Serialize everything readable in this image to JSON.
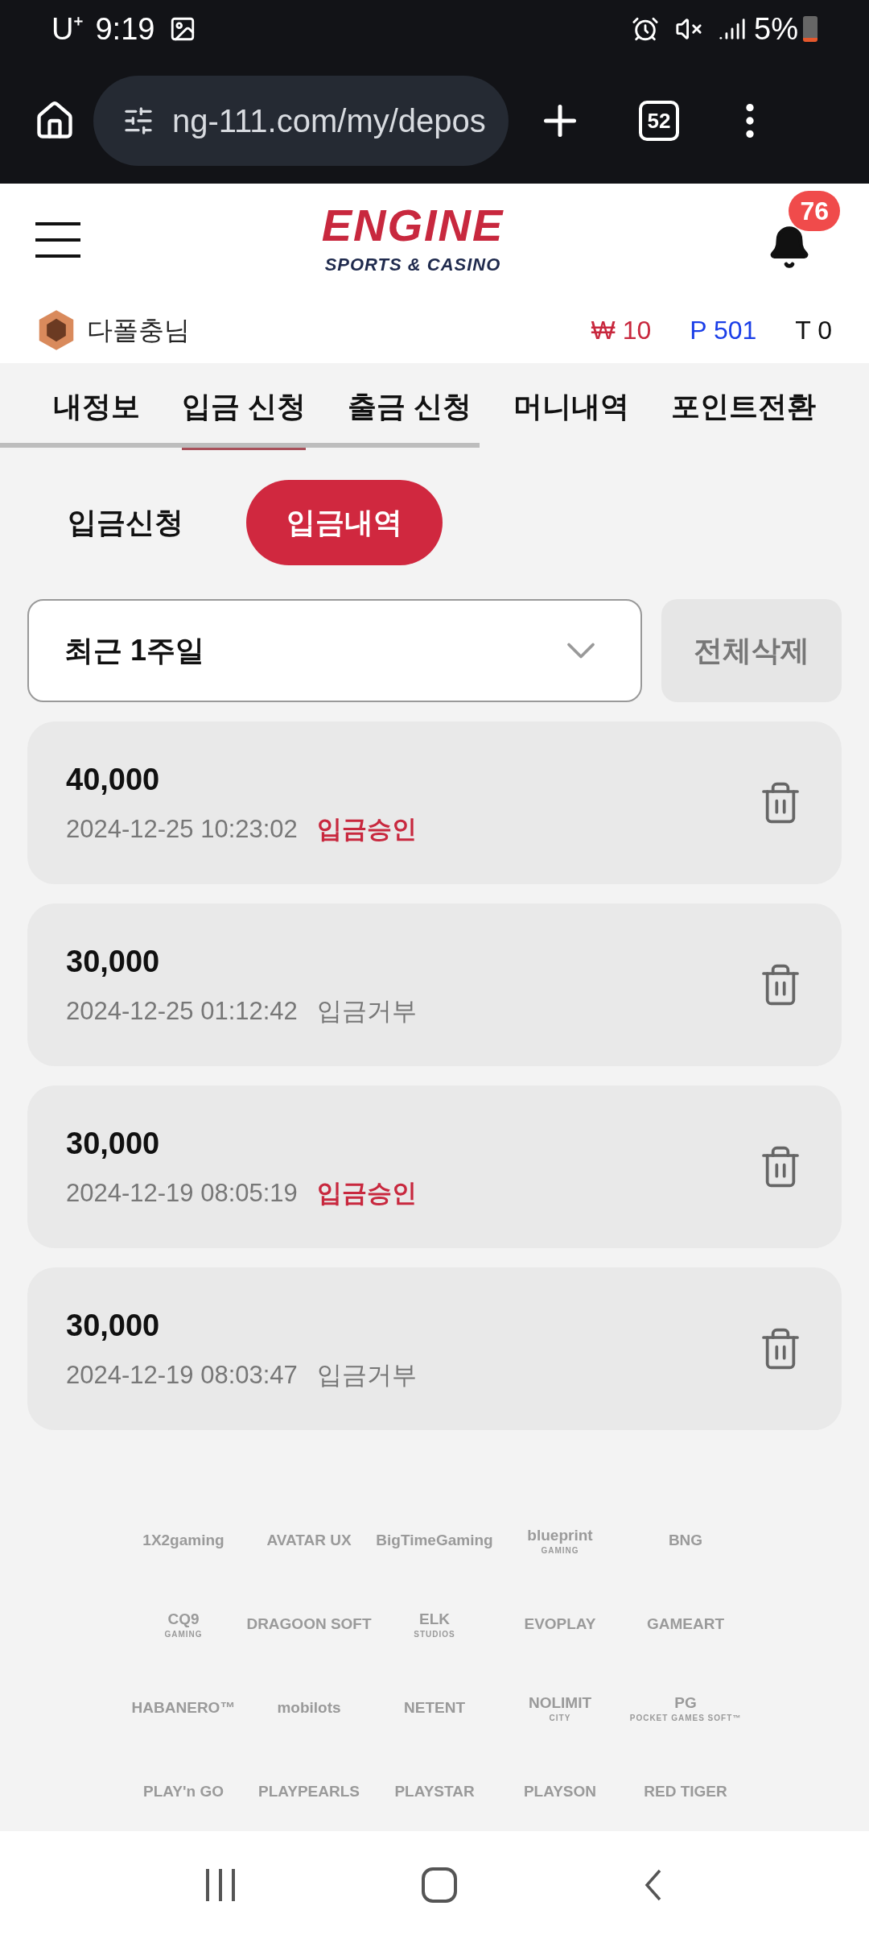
{
  "status_bar": {
    "carrier": "U⁺",
    "time": "9:19",
    "battery": "5%"
  },
  "browser": {
    "url": "ng-111.com/my/depos",
    "tab_count": "52"
  },
  "header": {
    "logo_title": "ENGINE",
    "logo_subtitle": "SPORTS & CASINO",
    "notification_count": "76"
  },
  "user": {
    "name": "다폴충님",
    "balances": [
      {
        "text": "₩ 10",
        "color": "#c8283e"
      },
      {
        "text": "P 501",
        "color": "#1a3ee8"
      },
      {
        "text": "T 0",
        "color": "#111111"
      }
    ]
  },
  "tabs": [
    {
      "label": "내정보",
      "selected": false
    },
    {
      "label": "입금 신청",
      "selected": true
    },
    {
      "label": "출금 신청",
      "selected": false
    },
    {
      "label": "머니내역",
      "selected": false
    },
    {
      "label": "포인트전환",
      "selected": false
    }
  ],
  "sub_tabs": [
    {
      "label": "입금신청",
      "selected": false
    },
    {
      "label": "입금내역",
      "selected": true
    }
  ],
  "filter": {
    "value": "최근 1주일",
    "delete_all": "전체삭제"
  },
  "records": [
    {
      "amount": "40,000",
      "datetime": "2024-12-25 10:23:02",
      "status": "입금승인",
      "kind": "approved"
    },
    {
      "amount": "30,000",
      "datetime": "2024-12-25 01:12:42",
      "status": "입금거부",
      "kind": "rejected"
    },
    {
      "amount": "30,000",
      "datetime": "2024-12-19 08:05:19",
      "status": "입금승인",
      "kind": "approved"
    },
    {
      "amount": "30,000",
      "datetime": "2024-12-19 08:03:47",
      "status": "입금거부",
      "kind": "rejected"
    }
  ],
  "providers": [
    {
      "name": "1X2gaming"
    },
    {
      "name": "AVATAR UX"
    },
    {
      "name": "BigTimeGaming"
    },
    {
      "name": "blueprint",
      "sub": "GAMING"
    },
    {
      "name": "BNG"
    },
    {
      "name": "CQ9",
      "sub": "GAMING"
    },
    {
      "name": "DRAGOON SOFT"
    },
    {
      "name": "ELK",
      "sub": "STUDIOS"
    },
    {
      "name": "EVOPLAY"
    },
    {
      "name": "GAMEART"
    },
    {
      "name": "HABANERO™"
    },
    {
      "name": "mobilots"
    },
    {
      "name": "NETENT"
    },
    {
      "name": "NOLIMIT",
      "sub": "CITY"
    },
    {
      "name": "PG",
      "sub": "POCKET GAMES SOFT™"
    },
    {
      "name": "PLAY'n GO"
    },
    {
      "name": "PLAYPEARLS"
    },
    {
      "name": "PLAYSTAR"
    },
    {
      "name": "PLAYSON"
    },
    {
      "name": "RED TIGER"
    }
  ]
}
